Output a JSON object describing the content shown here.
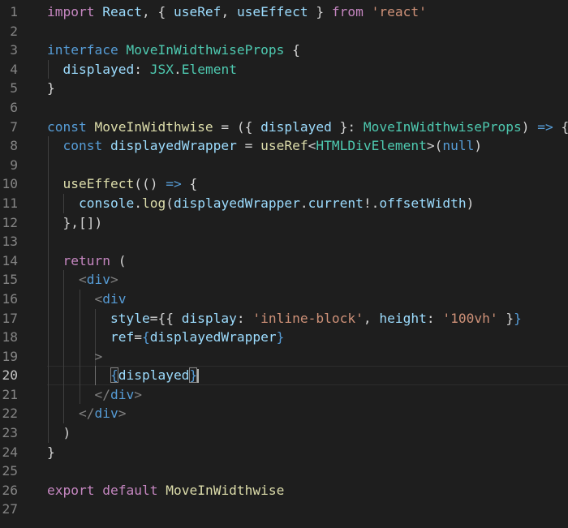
{
  "colors": {
    "keyword": "#c586c0",
    "storage": "#569cd6",
    "type": "#4ec9b0",
    "variable": "#9cdcfe",
    "function": "#dcdcaa",
    "string": "#ce9178",
    "tag": "#569cd6",
    "tag_bracket": "#808080",
    "punctuation": "#d4d4d4",
    "line_number": "#858585"
  },
  "editor": {
    "current_line": 20,
    "lines": [
      {
        "n": "1",
        "guides": [],
        "tokens": [
          {
            "t": "import",
            "c": "keyword"
          },
          {
            "t": " "
          },
          {
            "t": "React",
            "c": "variable"
          },
          {
            "t": ", { "
          },
          {
            "t": "useRef",
            "c": "variable"
          },
          {
            "t": ", "
          },
          {
            "t": "useEffect",
            "c": "variable"
          },
          {
            "t": " } "
          },
          {
            "t": "from",
            "c": "keyword"
          },
          {
            "t": " "
          },
          {
            "t": "'react'",
            "c": "string"
          }
        ]
      },
      {
        "n": "2",
        "guides": [],
        "tokens": []
      },
      {
        "n": "3",
        "guides": [],
        "tokens": [
          {
            "t": "interface",
            "c": "storage"
          },
          {
            "t": " "
          },
          {
            "t": "MoveInWidthwiseProps",
            "c": "type"
          },
          {
            "t": " {"
          }
        ]
      },
      {
        "n": "4",
        "guides": [
          0
        ],
        "tokens": [
          {
            "t": "  "
          },
          {
            "t": "displayed",
            "c": "variable"
          },
          {
            "t": ": "
          },
          {
            "t": "JSX",
            "c": "type"
          },
          {
            "t": "."
          },
          {
            "t": "Element",
            "c": "type"
          }
        ]
      },
      {
        "n": "5",
        "guides": [],
        "tokens": [
          {
            "t": "}"
          }
        ]
      },
      {
        "n": "6",
        "guides": [],
        "tokens": []
      },
      {
        "n": "7",
        "guides": [],
        "tokens": [
          {
            "t": "const",
            "c": "storage"
          },
          {
            "t": " "
          },
          {
            "t": "MoveInWidthwise",
            "c": "function"
          },
          {
            "t": " = ({ "
          },
          {
            "t": "displayed",
            "c": "variable"
          },
          {
            "t": " }: "
          },
          {
            "t": "MoveInWidthwiseProps",
            "c": "type"
          },
          {
            "t": ") "
          },
          {
            "t": "=>",
            "c": "storage"
          },
          {
            "t": " {"
          }
        ]
      },
      {
        "n": "8",
        "guides": [
          0
        ],
        "tokens": [
          {
            "t": "  "
          },
          {
            "t": "const",
            "c": "storage"
          },
          {
            "t": " "
          },
          {
            "t": "displayedWrapper",
            "c": "variable"
          },
          {
            "t": " = "
          },
          {
            "t": "useRef",
            "c": "function"
          },
          {
            "t": "<"
          },
          {
            "t": "HTMLDivElement",
            "c": "type"
          },
          {
            "t": ">("
          },
          {
            "t": "null",
            "c": "storage"
          },
          {
            "t": ")"
          }
        ]
      },
      {
        "n": "9",
        "guides": [
          0
        ],
        "tokens": []
      },
      {
        "n": "10",
        "guides": [
          0
        ],
        "tokens": [
          {
            "t": "  "
          },
          {
            "t": "useEffect",
            "c": "function"
          },
          {
            "t": "(() "
          },
          {
            "t": "=>",
            "c": "storage"
          },
          {
            "t": " {"
          }
        ]
      },
      {
        "n": "11",
        "guides": [
          0,
          1
        ],
        "tokens": [
          {
            "t": "    "
          },
          {
            "t": "console",
            "c": "variable"
          },
          {
            "t": "."
          },
          {
            "t": "log",
            "c": "function"
          },
          {
            "t": "("
          },
          {
            "t": "displayedWrapper",
            "c": "variable"
          },
          {
            "t": "."
          },
          {
            "t": "current",
            "c": "variable"
          },
          {
            "t": "!."
          },
          {
            "t": "offsetWidth",
            "c": "variable"
          },
          {
            "t": ")"
          }
        ]
      },
      {
        "n": "12",
        "guides": [
          0
        ],
        "tokens": [
          {
            "t": "  },[])"
          }
        ]
      },
      {
        "n": "13",
        "guides": [
          0
        ],
        "tokens": []
      },
      {
        "n": "14",
        "guides": [
          0
        ],
        "tokens": [
          {
            "t": "  "
          },
          {
            "t": "return",
            "c": "keyword"
          },
          {
            "t": " ("
          }
        ]
      },
      {
        "n": "15",
        "guides": [
          0,
          1
        ],
        "tokens": [
          {
            "t": "    "
          },
          {
            "t": "<",
            "c": "tag_bracket"
          },
          {
            "t": "div",
            "c": "tag"
          },
          {
            "t": ">",
            "c": "tag_bracket"
          }
        ]
      },
      {
        "n": "16",
        "guides": [
          0,
          1,
          2
        ],
        "tokens": [
          {
            "t": "      "
          },
          {
            "t": "<",
            "c": "tag_bracket"
          },
          {
            "t": "div",
            "c": "tag"
          }
        ]
      },
      {
        "n": "17",
        "guides": [
          0,
          1,
          2,
          3
        ],
        "tokens": [
          {
            "t": "        "
          },
          {
            "t": "style",
            "c": "variable"
          },
          {
            "t": "={{ "
          },
          {
            "t": "display",
            "c": "variable"
          },
          {
            "t": ": "
          },
          {
            "t": "'inline-block'",
            "c": "string"
          },
          {
            "t": ", "
          },
          {
            "t": "height",
            "c": "variable"
          },
          {
            "t": ": "
          },
          {
            "t": "'100vh'",
            "c": "string"
          },
          {
            "t": " }"
          },
          {
            "t": "}",
            "c": "storage"
          }
        ]
      },
      {
        "n": "18",
        "guides": [
          0,
          1,
          2,
          3
        ],
        "tokens": [
          {
            "t": "        "
          },
          {
            "t": "ref",
            "c": "variable"
          },
          {
            "t": "="
          },
          {
            "t": "{",
            "c": "storage"
          },
          {
            "t": "displayedWrapper",
            "c": "variable"
          },
          {
            "t": "}",
            "c": "storage"
          }
        ]
      },
      {
        "n": "19",
        "guides": [
          0,
          1,
          2,
          3
        ],
        "tokens": [
          {
            "t": "      "
          },
          {
            "t": ">",
            "c": "tag_bracket"
          }
        ]
      },
      {
        "n": "20",
        "guides": [
          0,
          1,
          2
        ],
        "active_guide": 3,
        "tokens": [
          {
            "t": "        "
          },
          {
            "t": "{",
            "c": "storage",
            "hl": true
          },
          {
            "t": "displayed",
            "c": "variable"
          },
          {
            "t": "}",
            "c": "storage",
            "hl": true
          },
          {
            "cursor": true
          }
        ]
      },
      {
        "n": "21",
        "guides": [
          0,
          1,
          2
        ],
        "tokens": [
          {
            "t": "      "
          },
          {
            "t": "</",
            "c": "tag_bracket"
          },
          {
            "t": "div",
            "c": "tag"
          },
          {
            "t": ">",
            "c": "tag_bracket"
          }
        ]
      },
      {
        "n": "22",
        "guides": [
          0,
          1
        ],
        "tokens": [
          {
            "t": "    "
          },
          {
            "t": "</",
            "c": "tag_bracket"
          },
          {
            "t": "div",
            "c": "tag"
          },
          {
            "t": ">",
            "c": "tag_bracket"
          }
        ]
      },
      {
        "n": "23",
        "guides": [
          0
        ],
        "tokens": [
          {
            "t": "  )"
          }
        ]
      },
      {
        "n": "24",
        "guides": [],
        "tokens": [
          {
            "t": "}"
          }
        ]
      },
      {
        "n": "25",
        "guides": [],
        "tokens": []
      },
      {
        "n": "26",
        "guides": [],
        "tokens": [
          {
            "t": "export",
            "c": "keyword"
          },
          {
            "t": " "
          },
          {
            "t": "default",
            "c": "keyword"
          },
          {
            "t": " "
          },
          {
            "t": "MoveInWidthwise",
            "c": "function"
          }
        ]
      },
      {
        "n": "27",
        "guides": [],
        "tokens": []
      }
    ]
  }
}
